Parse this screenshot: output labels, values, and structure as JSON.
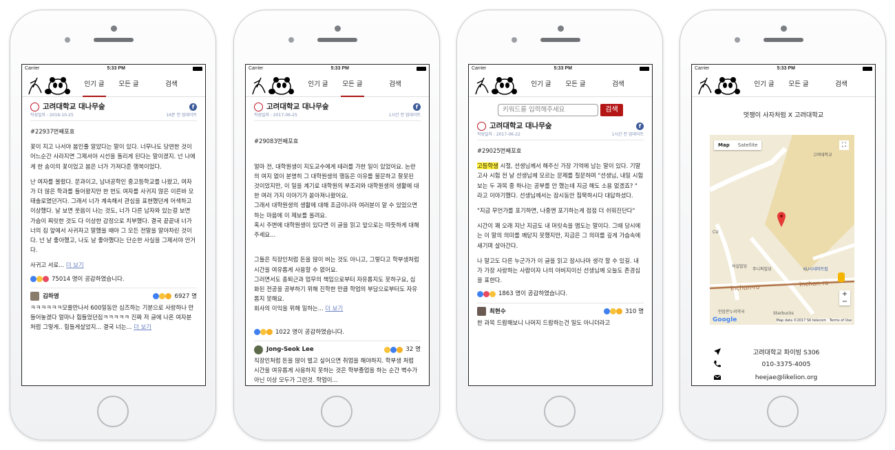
{
  "status": {
    "carrier": "Carrier",
    "time": "5:33 PM"
  },
  "tabs": [
    "인기 글",
    "모든 글",
    "검색"
  ],
  "page_name": "고려대학교 대나무숲",
  "phone1": {
    "meta_left": "작성일자 : 2016-10-25",
    "meta_right": "16분 전 업데이트",
    "post_no": "#22937번째포효",
    "p1": "꽃이 지고 나서야 봄인줄 알았다는 말이 있다. 너무나도 당연한 것이 어느순간 사라지면 그제서야 시선을 돌리게 된다는 말이겠지. 넌 나에게 한 송이의 꽃이었고 봄은 너가 가져다준 행복이었다.",
    "p2": "난 여자를 몰랐다. 문과이고, 남녀공학인 중고등학교를 나왔고, 여자가 더 많은 학과를 들어왔지만 한 번도 여자를 사귀지 않은 이른바 모태솔로였던거다. 그래서 너가 계속해서 관심을 표현했던게 어색하고 이상했다. 날 보면 웃음이 나는 것도, 너가 다른 남자와 있는걸 보면 가슴이 찌릿한 것도 다 이상한 감정으로 치부했다. 결국 끝끝내 너가 너의 집 앞에서 사귀자고 말했을 때야 그 모든 전말을 알아차린 것이다. 넌 날 좋아했고, 나도 날 좋아했다는 단순한 사실을 그제서야 안거다.",
    "p3": "사귀고 서로...",
    "more": "더 보기",
    "reactions": "75014 명이 공감하였습니다.",
    "commenter": "김하영",
    "c_count": "6927 명",
    "comment": "ㅋㅋㅋㅋㅋㅋ모쏠만나서 600일동안 심즈하는 기분으로 사랑하나 만들어놓겠다 얼마나 힘들었던집ㅋㅋㅋㅋㅋ 진짜 저 글에 나온 여자분처럼 그렇게.. 힘들게살았지... 결국 너는..."
  },
  "phone2": {
    "meta_left": "작성일자 : 2017-06-25",
    "meta_right": "1시간 전 업데이트",
    "post_no": "#29083번째포효",
    "p1": "얼마 전, 대학원생이 지도교수에게 테러를 가한 일이 있었어요. 논란의 여지 없이 분명히 그 대학원생의 행동은 이유를 불문하고 잘못된 것이었지만, 이 일을 계기로 대학원의 부조리와 대학원생의 생활에 대한 여러 가지 이야기가 쏟아져나왔어요.\n그래서 대학원생의 생활에 대해 조금이나마 여러분이 알 수 있었으면 하는 마음에 이 제보를 올려요.\n혹시 주변에 대학원생이 있다면 이 글을 읽고 앞으로는 따듯하게 대해주세요...",
    "p2": "그들은 직장인처럼 돈을 많이 버는 것도 아니고, 그렇다고 학부생처럼 시간을 여유롭게 사용할 수 없어요.\n그러면서도 총퇴근과 업무의 책임으로부터 자유롭지도 못하구요, 심화된 전공을 공부하기 위해 진학한 만큼 학업의 부담으로부터도 자유롭지 못해요.\n회사의 이익을 위해 일하는...",
    "more": "더 보기",
    "reactions": "1022 명이 공감하였습니다.",
    "commenter": "Jong-Seok Lee",
    "c_count": "32 명",
    "comment": "직장인처럼 돈을 많이 벌고 싶어으면 취업을 해야하지. 학부생 처럼 시간을 여유롭게 사용하지 못하는 것은 학부졸업을 하는 순간 벽수가 아닌 이상 모두가 그런것. 학업이..."
  },
  "phone3": {
    "search_placeholder": "키워드를 입력해주세요",
    "search_btn": "검색",
    "meta_left": "작성일자 : 2017-06-22",
    "meta_right": "1시간 전 업데이트",
    "post_no": "#29025번째포효",
    "hl": "고등학생",
    "p1": " 시절, 선생님께서 해주신 가장 기억에 남는 말이 있다. 기말고사 시험 전 날 선생님께 모르는 문제를 질문하며 \"선생님, 내일 시험 보는 두 과목 중 하나는 공부를 안 했는데 지금 해도 소용 없겠죠? \" 라고 이야기했다. 선생님께서는 잠시동안 침묵하시다 대답하셨다.",
    "p2": "\"지금 무언가를 포기하면, 나중엔 포기하는게 점점 더 쉬워진단다\"",
    "p3": "시간이 꽤 오래 지난 지금도 내 머릿속을 맴도는 말이다. 그때 당시에는 이 말의 의미를 깨닫지 못했지만, 지금은 그 의미를 깊게 가슴속에 새기며 살아간다.",
    "p4": "나 말고도 다른 누군가가 이 글을 읽고 잠시나마 생각 할 수 있길. 내가 가장 사랑하는 사람이자 나의 아버지이신 선생님께 오늘도 존경심을 표한다.",
    "reactions": "1863 명이 공감하였습니다.",
    "commenter": "최현수",
    "c_count": "310 명",
    "comment": "한 과목 드랍해보니 나머지 드랍하는건 일도 아니더라고"
  },
  "phone4": {
    "contact_title": "멋쟁이 사자처럼 X 고려대학교",
    "map": {
      "map_btn": "Map",
      "sat_btn": "Satellite",
      "road": "Inchon-ro",
      "label1": "고려대학교",
      "label2": "KU시네마트럽",
      "label3": "주니퍼빌딩",
      "label4": "석실빌딩",
      "label5": "Starbucks",
      "label6": "CU",
      "label7": "안암온누리약국",
      "label8": "Google",
      "credit": "Map data ©2017 SK telecom   Terms of Use",
      "zoom_in": "+",
      "zoom_out": "−"
    },
    "address": "고려대학교 파이빙 S306",
    "phone": "010-3375-4005",
    "email": "heejae@likelion.org"
  }
}
